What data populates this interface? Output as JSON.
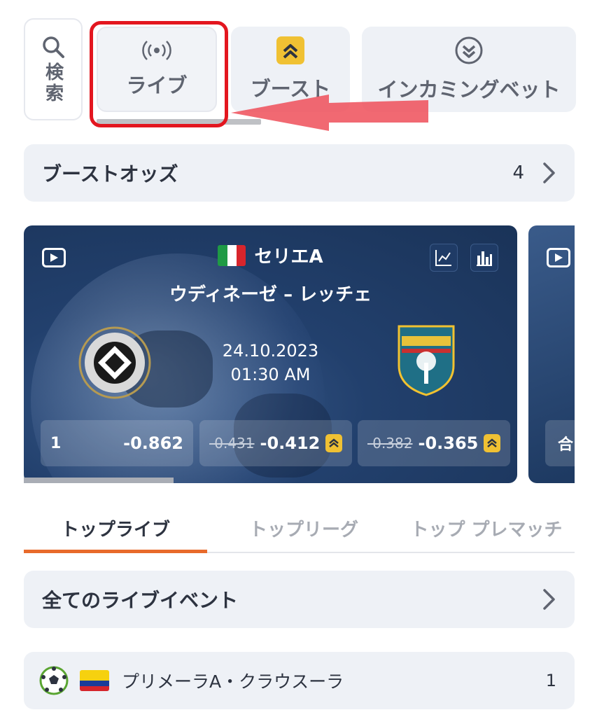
{
  "nav": {
    "search_label": "検索",
    "live_label": "ライブ",
    "boost_label": "ブースト",
    "incoming_label": "インカミングベット"
  },
  "boost_odds": {
    "title": "ブーストオッズ",
    "count": "4"
  },
  "match_card": {
    "league": "セリエA",
    "match": "ウディネーゼ – レッチェ",
    "date": "24.10.2023",
    "time": "01:30 AM",
    "odds": [
      {
        "label": "1",
        "old": "",
        "value": "-0.862",
        "boosted": false
      },
      {
        "label": "",
        "old": "-0.431",
        "value": "-0.412",
        "boosted": true
      },
      {
        "label": "",
        "old": "-0.382",
        "value": "-0.365",
        "boosted": true
      }
    ],
    "next_card_label": "合"
  },
  "tabs": [
    {
      "label": "トップライブ",
      "active": true
    },
    {
      "label": "トップリーグ",
      "active": false
    },
    {
      "label": "トップ プレマッチ",
      "active": false
    }
  ],
  "all_live": {
    "title": "全てのライブイベント"
  },
  "league_row": {
    "name": "プリメーラA・クラウスーラ",
    "count": "1"
  },
  "colors": {
    "highlight": "#e3161f",
    "accent": "#e86a2b",
    "boost": "#f0c133",
    "card_bg": "#22406d"
  }
}
